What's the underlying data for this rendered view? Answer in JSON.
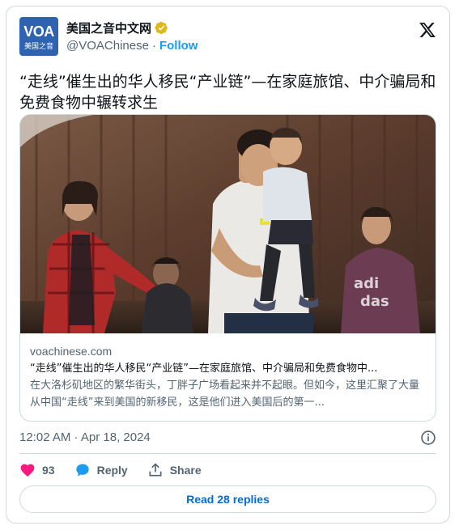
{
  "account": {
    "display_name": "美国之音中文网",
    "handle": "@VOAChinese",
    "separator": "·",
    "follow_label": "Follow",
    "avatar_logo_text": "VOA",
    "avatar_sub_text": "美国之音",
    "verified": true,
    "verified_color": "#e2b719"
  },
  "post": {
    "text": "“走线”催生出的华人移民“产业链”—在家庭旅馆、中介骗局和免费食物中辗转求生"
  },
  "link_card": {
    "domain": "voachinese.com",
    "title": "“走线”催生出的华人移民“产业链”—在家庭旅馆、中介骗局和免费食物中...",
    "description": "在大洛杉矶地区的繁华街头，丁胖子广场看起来并不起眼。但如今，这里汇聚了大量从中国“走线”来到美国的新移民，这是他们进入美国后的第一..."
  },
  "meta": {
    "timestamp": "12:02 AM · Apr 18, 2024"
  },
  "actions": {
    "like_count": "93",
    "reply_label": "Reply",
    "share_label": "Share",
    "read_replies_label": "Read 28 replies"
  },
  "colors": {
    "accent": "#1d9bf0",
    "like": "#f91880",
    "text": "#0f1419",
    "muted": "#536471",
    "border": "#cfd9de"
  },
  "icons": [
    "x-logo-icon",
    "verified-badge-icon",
    "info-icon",
    "heart-icon",
    "reply-bubble-icon",
    "share-icon"
  ]
}
